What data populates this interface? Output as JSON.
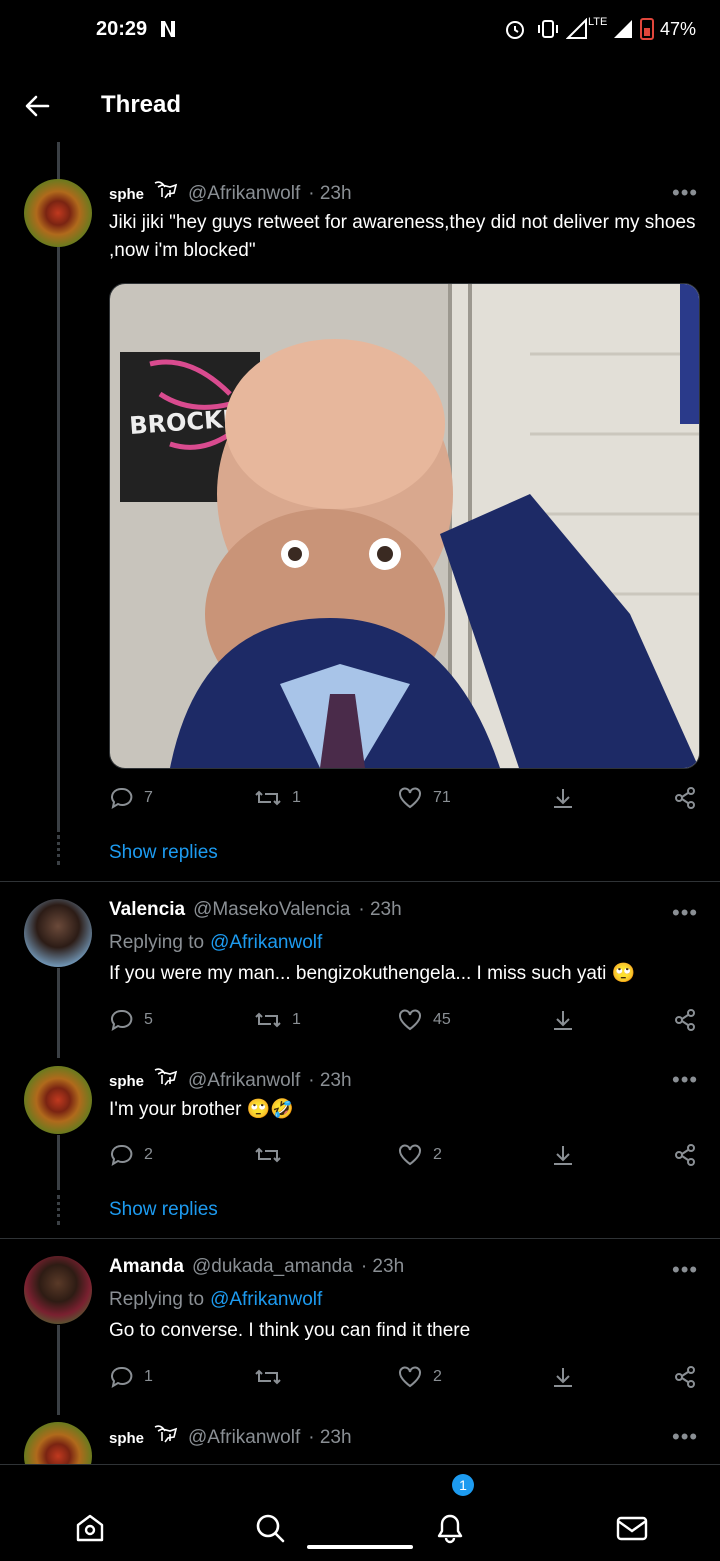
{
  "status": {
    "time": "20:29",
    "network": "LTE",
    "battery": "47%"
  },
  "header": {
    "title": "Thread"
  },
  "tweets": [
    {
      "name": "sphe",
      "handle": "@Afrikanwolf",
      "time": "· 23h",
      "text": "Jiki jiki \"hey guys retweet for awareness,they did not deliver my shoes ,now i'm blocked\"",
      "image_caption": "BROCKL",
      "replies": "7",
      "retweets": "1",
      "likes": "71"
    },
    {
      "name": "Valencia",
      "handle": "@MasekoValencia",
      "time": "· 23h",
      "replying_prefix": "Replying to",
      "replying_to": "@Afrikanwolf",
      "text": "If you were my man... bengizokuthengela... I miss such yati 🙄",
      "replies": "5",
      "retweets": "1",
      "likes": "45"
    },
    {
      "name": "sphe",
      "handle": "@Afrikanwolf",
      "time": "· 23h",
      "text": "I'm your brother 🙄🤣",
      "replies": "2",
      "retweets": "",
      "likes": "2"
    },
    {
      "name": "Amanda",
      "handle": "@dukada_amanda",
      "time": "· 23h",
      "replying_prefix": "Replying to",
      "replying_to": "@Afrikanwolf",
      "text": "Go to converse. I think you can find it there",
      "replies": "1",
      "retweets": "",
      "likes": "2"
    },
    {
      "name": "sphe",
      "handle": "@Afrikanwolf",
      "time": "· 23h"
    }
  ],
  "show_replies": "Show replies",
  "more_label": "•••",
  "tabbar": {
    "notifications_badge": "1"
  },
  "colors": {
    "accent": "#1d9bf0",
    "muted": "#8a8f94",
    "background": "#000000"
  }
}
